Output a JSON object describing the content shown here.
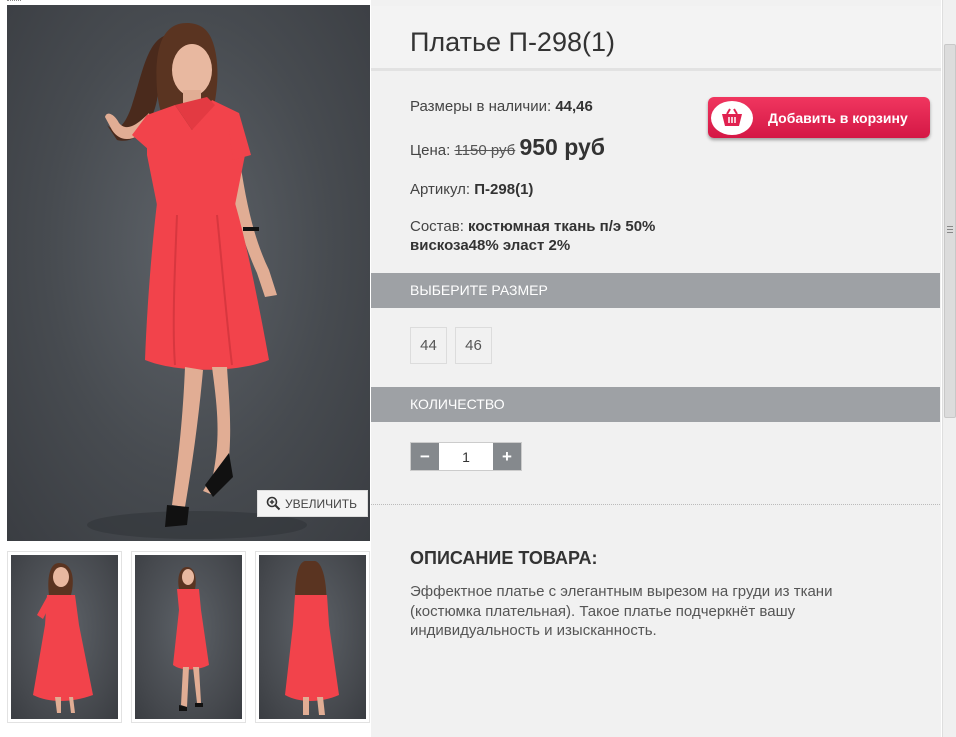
{
  "product": {
    "title": "Платье П-298(1)",
    "sizes_label": "Размеры в наличии:",
    "sizes_value": "44,46",
    "price_label": "Цена:",
    "old_price": "1150 руб",
    "new_price": "950 руб",
    "article_label": "Артикул:",
    "article_value": "П-298(1)",
    "composition_label": "Состав:",
    "composition_value_line1": "костюмная ткань п/э 50%",
    "composition_value_line2": "вискоза48% эласт 2%"
  },
  "gallery": {
    "zoom_label": "УВЕЛИЧИТЬ",
    "thumbnail_count": 3
  },
  "cart": {
    "button_label": "Добавить в корзину",
    "icon": "basket-icon"
  },
  "size_section": {
    "heading": "ВЫБЕРИТЕ РАЗМЕР",
    "options": [
      "44",
      "46"
    ]
  },
  "quantity_section": {
    "heading": "КОЛИЧЕСТВО",
    "minus": "−",
    "plus": "+",
    "value": "1"
  },
  "description": {
    "heading": "ОПИСАНИЕ ТОВАРА:",
    "text": "Эффектное платье с элегантным вырезом на груди из ткани (костюмка плательная). Такое платье подчеркнёт вашу индивидуальность и изысканность."
  },
  "colors": {
    "dress": "#f2434b",
    "cart_button": "#e0214f",
    "section_header": "#9ea1a5",
    "photo_background": "#4a4e53"
  }
}
